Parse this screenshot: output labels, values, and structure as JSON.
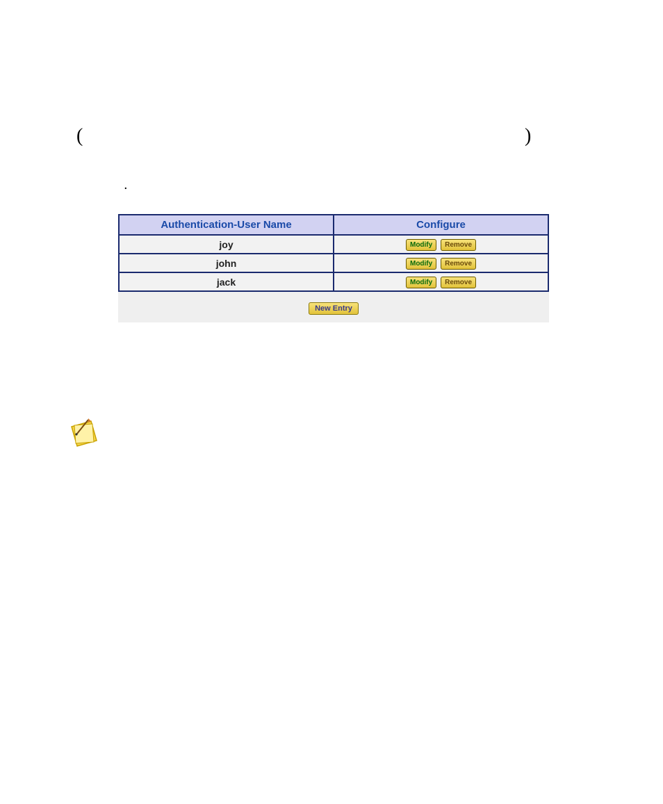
{
  "decor": {
    "paren_left": "(",
    "paren_right": ")",
    "dot": "."
  },
  "table": {
    "headers": {
      "user": "Authentication-User Name",
      "configure": "Configure"
    },
    "rows": [
      {
        "name": "joy"
      },
      {
        "name": "john"
      },
      {
        "name": "jack"
      }
    ],
    "buttons": {
      "modify": "Modify",
      "remove": "Remove",
      "new_entry": "New Entry"
    }
  },
  "icons": {
    "note": "note-icon"
  }
}
